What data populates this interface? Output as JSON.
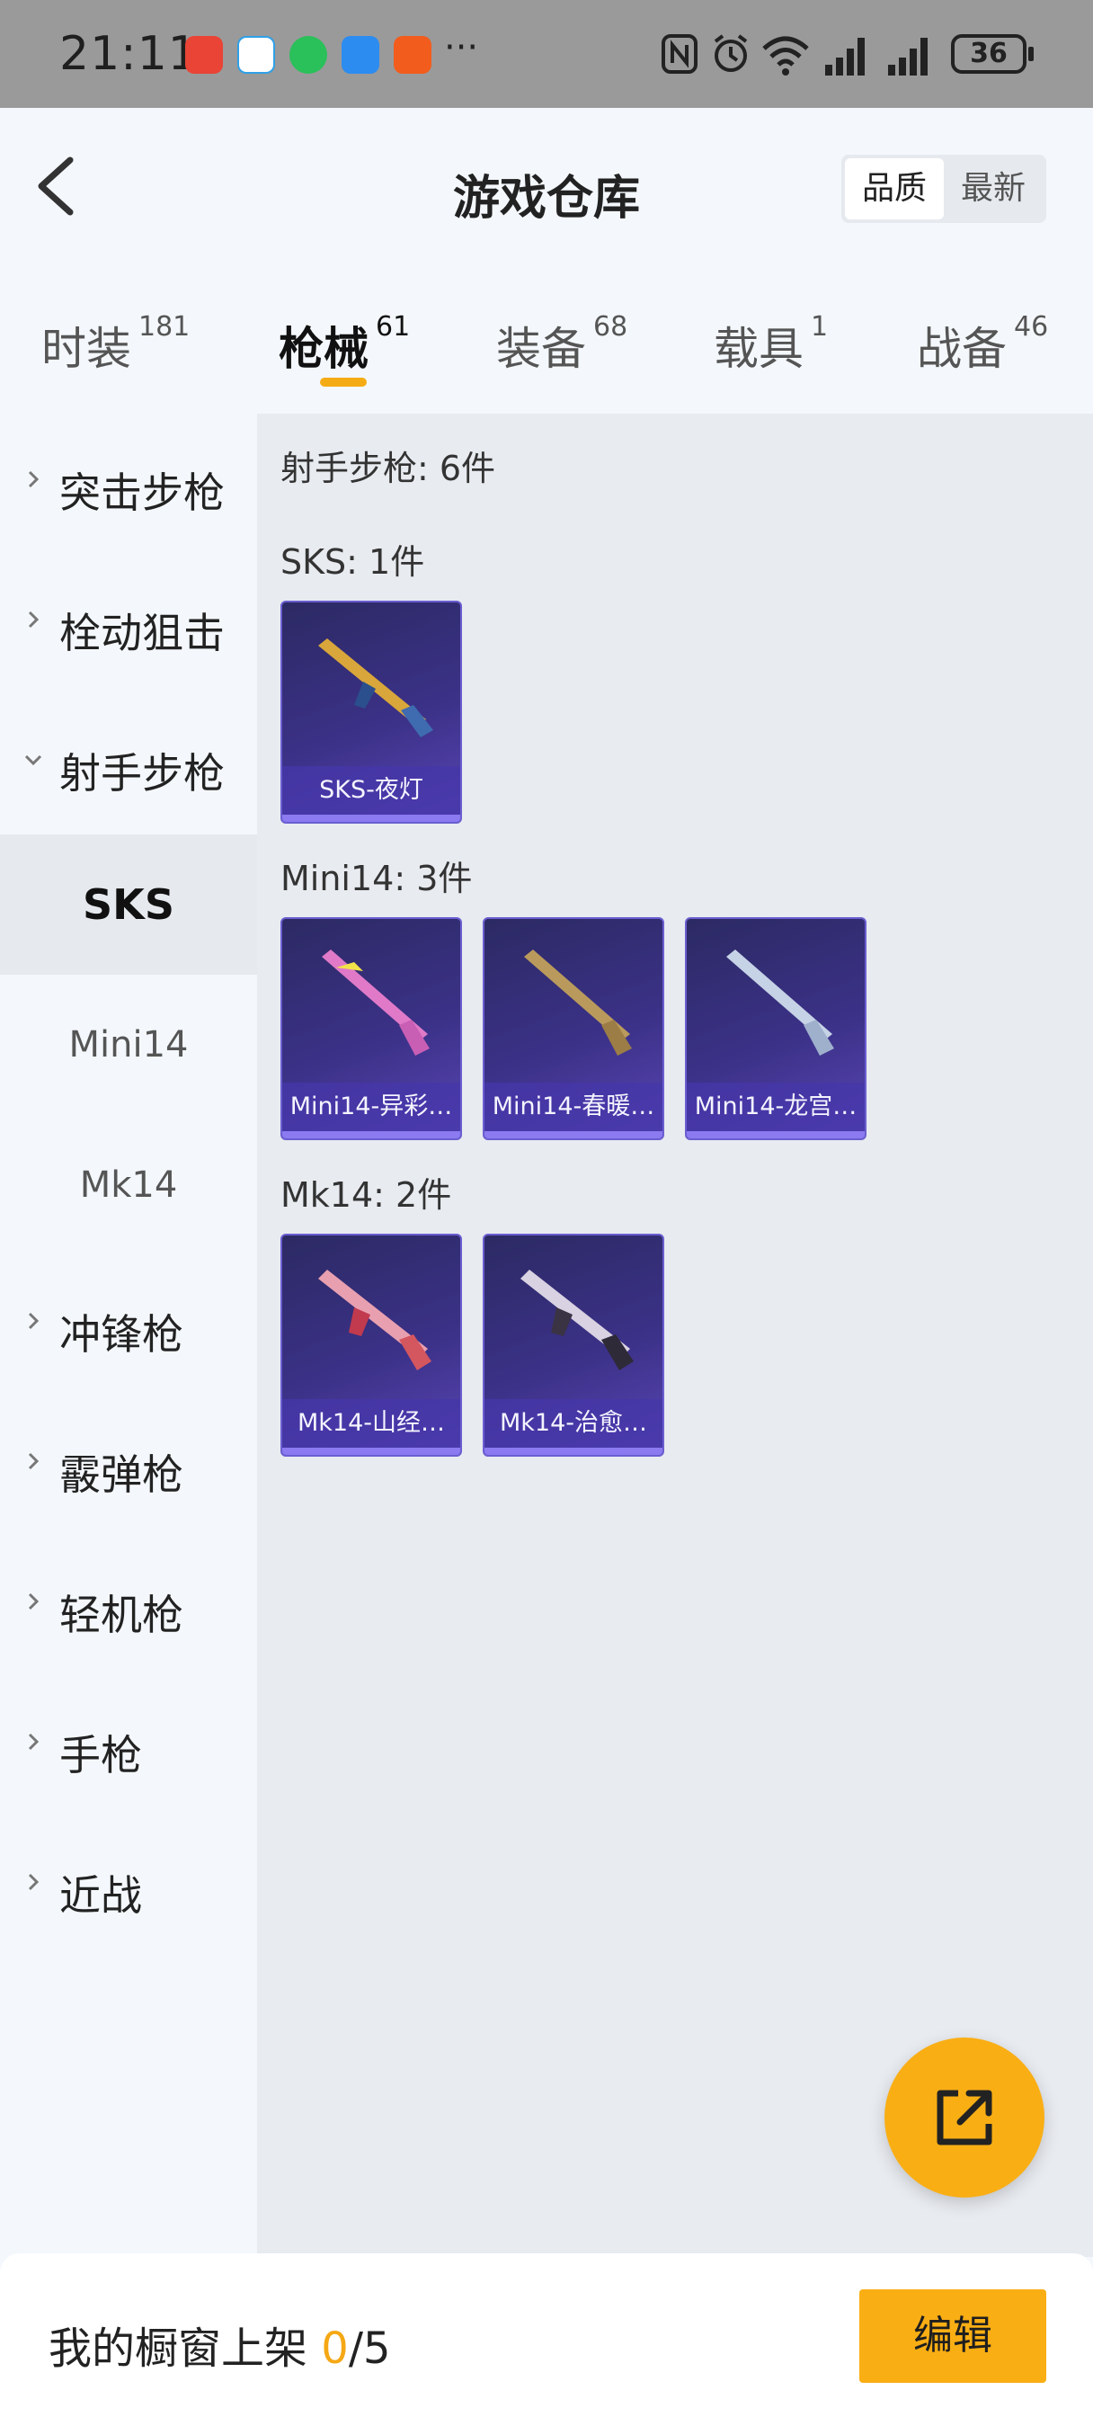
{
  "status_bar": {
    "time": "21:11",
    "more": "···",
    "battery": "36",
    "app_icons": [
      "red-game-icon",
      "blue-app-icon",
      "wechat-icon",
      "message-icon",
      "taobao-icon"
    ],
    "right_icons": [
      "nfc-icon",
      "alarm-icon",
      "wifi-icon",
      "signal-icon",
      "signal-icon"
    ]
  },
  "header": {
    "title": "游戏仓库",
    "sort_options": [
      "品质",
      "最新"
    ],
    "sort_selected": "品质"
  },
  "tabs": [
    {
      "label": "时装",
      "count": "181"
    },
    {
      "label": "枪械",
      "count": "61",
      "active": true
    },
    {
      "label": "装备",
      "count": "68"
    },
    {
      "label": "载具",
      "count": "1"
    },
    {
      "label": "战备",
      "count": "46"
    }
  ],
  "sidebar": {
    "categories": [
      "突击步枪",
      "栓动狙击",
      "射手步枪",
      "冲锋枪",
      "霰弹枪",
      "轻机枪",
      "手枪",
      "近战"
    ],
    "expanded": "射手步枪",
    "subcategories": [
      "SKS",
      "Mini14",
      "Mk14"
    ],
    "active_sub": "SKS"
  },
  "content": {
    "summary": "射手步枪: 6件",
    "groups": [
      {
        "title": "SKS: 1件",
        "items": [
          "SKS-夜灯"
        ]
      },
      {
        "title": "Mini14: 3件",
        "items": [
          "Mini14-异彩…",
          "Mini14-春暖…",
          "Mini14-龙宫…"
        ]
      },
      {
        "title": "Mk14: 2件",
        "items": [
          "Mk14-山经…",
          "Mk14-治愈…"
        ]
      }
    ]
  },
  "fab": {
    "icon": "share-icon"
  },
  "bottom": {
    "label": "我的橱窗上架 ",
    "count": "0",
    "total": "/5",
    "edit_label": "编辑"
  },
  "colors": {
    "accent": "#f9ae14",
    "card_bg": "#3b3187",
    "page_bg": "#f4f8fc",
    "content_bg": "#e8ebf0"
  }
}
